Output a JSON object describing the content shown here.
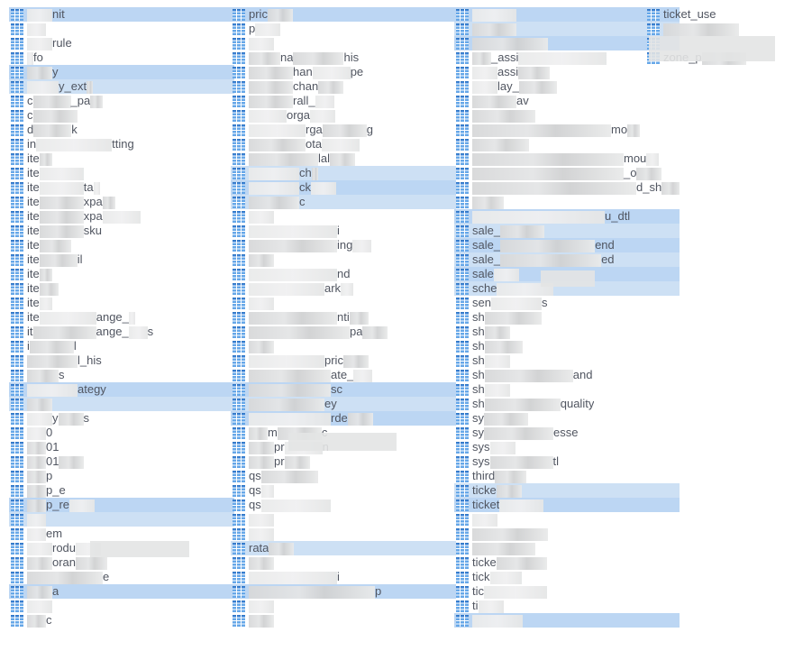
{
  "columns": [
    {
      "sel_indices": [
        0,
        4,
        5,
        26,
        27,
        34,
        35,
        40
      ],
      "items": [
        "████nit",
        "███",
        "████rule",
        "█fo",
        "████y",
        "█████y_ext█",
        "c██████_pa██",
        "c███████",
        "d██████k",
        "in████████████tting",
        "ite██",
        "ite███████",
        "ite███████ta█",
        "ite███████xpa██",
        "ite███████xpa██████",
        "ite███████sku",
        "ite█████",
        "ite██████il",
        "ite██",
        "ite███",
        "ite██",
        "ite█████████ange_█",
        "it██████████ange_███s",
        "i███████l",
        "████████l_his",
        "█████s",
        "████████ategy",
        "████",
        "████y████s",
        "███0",
        "███01",
        "███01████",
        "███p",
        "███p_e",
        "███p_re████",
        "███",
        "███em",
        "████rodu████",
        "████oran█████",
        "████████████e",
        "████a",
        "████",
        "███c"
      ]
    },
    {
      "sel_indices": [
        0,
        11,
        12,
        13,
        26,
        27,
        28,
        37,
        40
      ],
      "items": [
        "pric████",
        "p████",
        "████",
        "█████na████████his",
        "███████han██████pe",
        "███████chan████",
        "███████rall_███",
        "██████orga████",
        "█████████rga███████g",
        "█████████ota██████",
        "███████████lal████",
        "████████ch█",
        "████████ck████",
        "████████c",
        "████",
        "██████████████i",
        "██████████████ing███",
        "████",
        "██████████████nd",
        "████████████ark██",
        "████",
        "██████████████nti███",
        "████████████████pa████",
        "████",
        "████████████pric████",
        "█████████████ate_███",
        "█████████████sc",
        "████████████ey",
        "█████████████rde████",
        "███m███████c",
        "████pr██████n",
        "████pr████",
        "qs█████████",
        "qs██",
        "qs███████████",
        "████",
        "████",
        "rata████",
        "████",
        "██████████████i",
        "████████████████████p",
        "████",
        "████"
      ]
    },
    {
      "sel_indices": [
        0,
        1,
        2,
        14,
        15,
        16,
        17,
        18,
        19,
        33,
        34,
        42
      ],
      "items": [
        "███████",
        "███████",
        "████████████",
        "███_assi██████████████",
        "████assi█████",
        "████lay_██████",
        "███████av",
        "██████████",
        "██████████████████████mo██",
        "█████████",
        "████████████████████████mou██",
        "████████████████████████_o████",
        "██████████████████████████d_sh███",
        "█████",
        "█████████████████████u_dtl",
        "sale_███████",
        "sale_███████████████end",
        "sale_████████████████ed",
        "sale████",
        "sche█████████",
        "sen████████s",
        "sh█████████",
        "sh████",
        "sh██████",
        "sh████",
        "sh██████████████and",
        "sh████",
        "sh████████████quality",
        "sy███████",
        "sy███████████esse",
        "sys████",
        "sys██████████tl",
        "third█████",
        "ticke████",
        "ticket███████",
        "████",
        "████████████",
        "██████████",
        "ticke████████",
        "tick█████",
        "tic██████████",
        "ti████",
        "████████"
      ]
    },
    {
      "sel_indices": [],
      "items": [
        "ticket_use",
        "████████████",
        "",
        "zone_p███████"
      ]
    }
  ]
}
